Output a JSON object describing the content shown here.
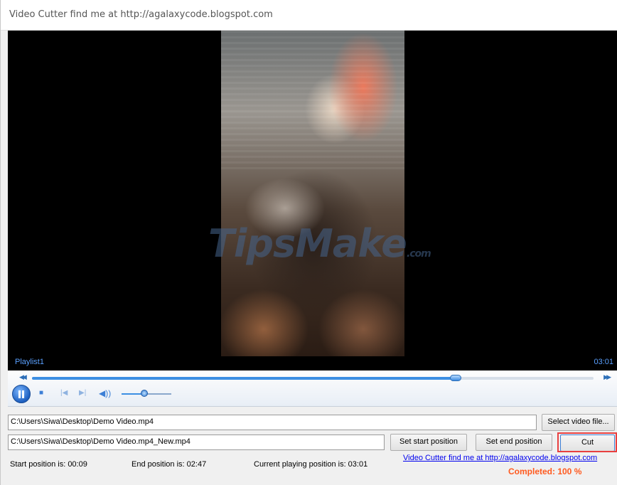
{
  "window": {
    "title": "Video Cutter find me at http://agalaxycode.blogspot.com"
  },
  "player": {
    "playlist_label": "Playlist1",
    "duration": "03:01",
    "watermark_main": "TipsMake",
    "watermark_suffix": ".com",
    "seek_fraction": 0.755,
    "volume_fraction": 0.45
  },
  "controls": {
    "play_pause_icon": "pause-icon",
    "stop_icon": "stop-icon",
    "previous_icon": "previous-icon",
    "next_icon": "next-icon",
    "volume_icon": "volume-icon",
    "rewind_icon": "rewind-icon",
    "fast_forward_icon": "fast-forward-icon"
  },
  "form": {
    "input_path": "C:\\Users\\Siwa\\Desktop\\Demo Video.mp4",
    "output_path": "C:\\Users\\Siwa\\Desktop\\Demo Video.mp4_New.mp4",
    "select_button": "Select video file...",
    "set_start_button": "Set start position",
    "set_end_button": "Set end position",
    "cut_button": "Cut"
  },
  "status": {
    "start_position": "Start position is: 00:09",
    "end_position": "End position is: 02:47",
    "current_position": "Current playing position is: 03:01",
    "link_text": "Video Cutter find me at http://agalaxycode.blogspot.com",
    "completed": "Completed:  100 %"
  },
  "colors": {
    "accent": "#3c8fe3",
    "completed_text": "#ff5a1f",
    "highlight_border": "#e84040"
  }
}
